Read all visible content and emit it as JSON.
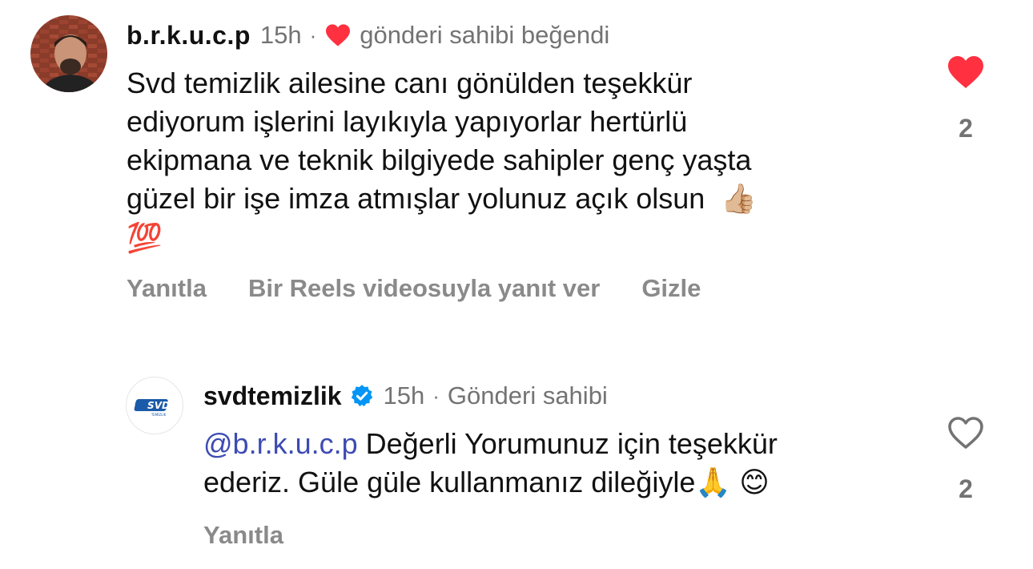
{
  "comments": [
    {
      "username": "b.r.k.u.c.p",
      "time": "15h",
      "separator": "·",
      "liked_by_owner": "gönderi sahibi beğendi",
      "text_lines": [
        "Svd temizlik ailesine canı gönülden teşekkür",
        "ediyorum işlerini layıkıyla yapıyorlar hertürlü",
        "ekipmana ve teknik bilgiyede sahipler genç yaşta",
        "güzel bir işe imza atmışlar yolunuz açık olsun"
      ],
      "emoji_thumb": "👍🏼",
      "emoji_100": "💯",
      "actions": [
        "Yanıtla",
        "Bir Reels videosuyla yanıt ver",
        "Gizle"
      ],
      "like_count": "2",
      "liked": true
    },
    {
      "username": "svdtemizlik",
      "time": "15h",
      "separator": "·",
      "owner_label": "Gönderi sahibi",
      "mention": "@b.r.k.u.c.p",
      "text_rest_line1": " Değerli Yorumunuz için teşekkür",
      "text_line2": "ederiz. Güle güle kullanmanız dileğiyle",
      "emoji_pray": "🙏",
      "emoji_smile": "😊",
      "actions": [
        "Yanıtla"
      ],
      "like_count": "2",
      "liked": false,
      "logo_text": "SVD",
      "logo_subtext": "TEMİZLİK"
    }
  ],
  "colors": {
    "heart_red": "#ff3040",
    "verified_blue": "#0095f6",
    "mention_blue": "#3d4bb3",
    "muted_gray": "#737373"
  }
}
